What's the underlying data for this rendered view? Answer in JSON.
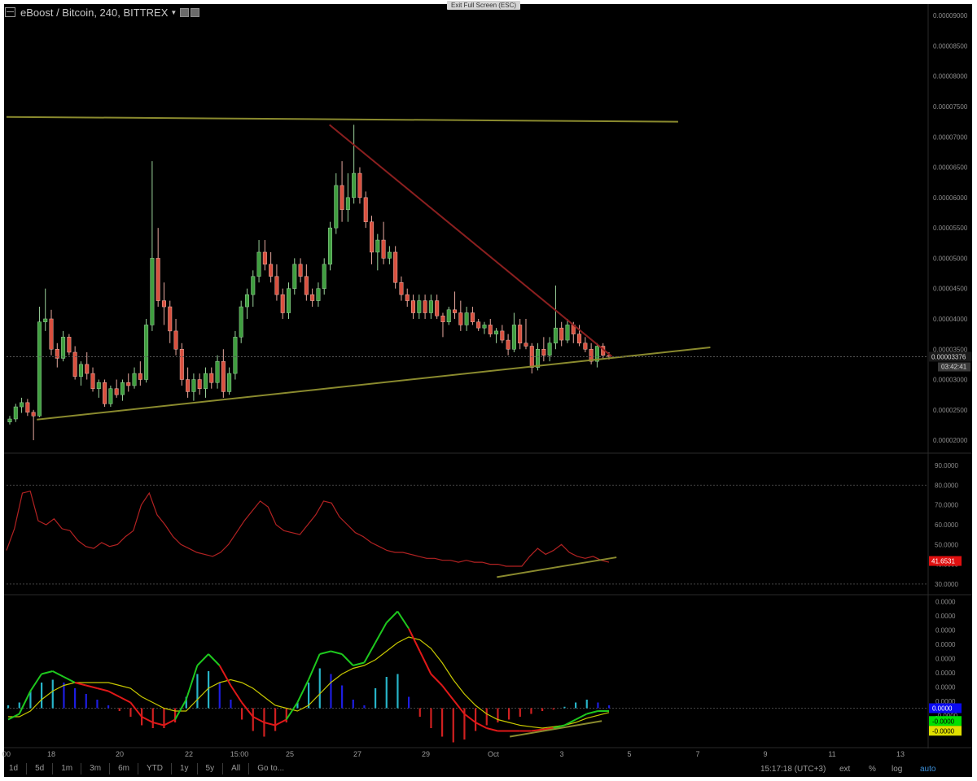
{
  "header": {
    "symbol": "eBoost / Bitcoin, 240, BITTREX"
  },
  "fullscreen_hint": "Exit Full Screen (ESC)",
  "toolbar": {
    "ranges": [
      "1d",
      "5d",
      "1m",
      "3m",
      "6m",
      "YTD",
      "1y",
      "5y",
      "All",
      "Go to..."
    ],
    "clock": "15:17:18 (UTC+3)",
    "ext": "ext",
    "percent": "%",
    "log": "log",
    "auto": "auto"
  },
  "colors": {
    "up": "#3f9e3f",
    "down": "#d9503f",
    "trendline": "#8a8a2e",
    "resistance": "#8b1f1f",
    "rsi": "#b22222",
    "macd": "#1ec81e",
    "signal": "#c8c800",
    "hist_pos_dark": "#1d1de0",
    "hist_pos_light": "#27b4c8",
    "hist_neg": "#d02020"
  },
  "chart_data": [
    {
      "type": "candlestick",
      "pane": "price",
      "x_ticks": [
        "00",
        "18",
        "20",
        "22",
        "15:00",
        "25",
        "27",
        "29",
        "Oct",
        "3",
        "5",
        "7",
        "9",
        "11",
        "13"
      ],
      "y_ticks": [
        "0.00009000",
        "0.00008500",
        "0.00008000",
        "0.00007500",
        "0.00007000",
        "0.00006500",
        "0.00006000",
        "0.00005500",
        "0.00005000",
        "0.00004500",
        "0.00004000",
        "0.00003500",
        "0.00003000",
        "0.00002500",
        "0.00002000"
      ],
      "ylim": [
        1.8e-05,
        9.15e-05
      ],
      "last_price_label": "0.00003376",
      "countdown_label": "03:42:41",
      "candles": [
        [
          2.3e-05,
          2.4e-05,
          2.26e-05,
          2.35e-05
        ],
        [
          2.35e-05,
          2.6e-05,
          2.3e-05,
          2.55e-05
        ],
        [
          2.55e-05,
          2.7e-05,
          2.45e-05,
          2.62e-05
        ],
        [
          2.62e-05,
          2.68e-05,
          2.4e-05,
          2.46e-05
        ],
        [
          2.46e-05,
          2.5e-05,
          2e-05,
          2.4e-05
        ],
        [
          2.4e-05,
          4.2e-05,
          2.38e-05,
          3.95e-05
        ],
        [
          3.95e-05,
          4.5e-05,
          3.8e-05,
          4e-05
        ],
        [
          4e-05,
          4.15e-05,
          3.4e-05,
          3.5e-05
        ],
        [
          3.5e-05,
          3.6e-05,
          3.2e-05,
          3.35e-05
        ],
        [
          3.35e-05,
          3.8e-05,
          3.3e-05,
          3.7e-05
        ],
        [
          3.7e-05,
          3.75e-05,
          3.4e-05,
          3.45e-05
        ],
        [
          3.45e-05,
          3.55e-05,
          3e-05,
          3.05e-05
        ],
        [
          3.05e-05,
          3.3e-05,
          2.9e-05,
          3.25e-05
        ],
        [
          3.25e-05,
          3.45e-05,
          3e-05,
          3.1e-05
        ],
        [
          3.1e-05,
          3.2e-05,
          2.8e-05,
          2.85e-05
        ],
        [
          2.85e-05,
          3e-05,
          2.7e-05,
          2.95e-05
        ],
        [
          2.95e-05,
          3e-05,
          2.55e-05,
          2.6e-05
        ],
        [
          2.6e-05,
          2.9e-05,
          2.55e-05,
          2.85e-05
        ],
        [
          2.85e-05,
          3e-05,
          2.7e-05,
          2.75e-05
        ],
        [
          2.75e-05,
          3e-05,
          2.65e-05,
          2.95e-05
        ],
        [
          2.95e-05,
          3.1e-05,
          2.8e-05,
          2.9e-05
        ],
        [
          2.9e-05,
          3.2e-05,
          2.85e-05,
          3.1e-05
        ],
        [
          3.1e-05,
          3.3e-05,
          2.9e-05,
          3e-05
        ],
        [
          3e-05,
          4e-05,
          2.95e-05,
          3.9e-05
        ],
        [
          3.9e-05,
          6.6e-05,
          3.8e-05,
          5e-05
        ],
        [
          5e-05,
          5.5e-05,
          4.2e-05,
          4.3e-05
        ],
        [
          4.3e-05,
          4.6e-05,
          3.9e-05,
          4.2e-05
        ],
        [
          4.2e-05,
          4.3e-05,
          3.6e-05,
          3.8e-05
        ],
        [
          3.8e-05,
          4e-05,
          3.4e-05,
          3.5e-05
        ],
        [
          3.5e-05,
          3.6e-05,
          2.9e-05,
          3e-05
        ],
        [
          3e-05,
          3.2e-05,
          2.7e-05,
          2.8e-05
        ],
        [
          2.8e-05,
          3.1e-05,
          2.65e-05,
          3e-05
        ],
        [
          3e-05,
          3.1e-05,
          2.75e-05,
          2.85e-05
        ],
        [
          2.85e-05,
          3.2e-05,
          2.7e-05,
          3.1e-05
        ],
        [
          3.1e-05,
          3.2e-05,
          2.85e-05,
          2.95e-05
        ],
        [
          2.95e-05,
          3.4e-05,
          2.85e-05,
          3.3e-05
        ],
        [
          3.3e-05,
          3.5e-05,
          2.7e-05,
          2.8e-05
        ],
        [
          2.8e-05,
          3.2e-05,
          2.75e-05,
          3.1e-05
        ],
        [
          3.1e-05,
          3.8e-05,
          3e-05,
          3.7e-05
        ],
        [
          3.7e-05,
          4.3e-05,
          3.6e-05,
          4.2e-05
        ],
        [
          4.2e-05,
          4.5e-05,
          4e-05,
          4.4e-05
        ],
        [
          4.4e-05,
          4.8e-05,
          4.2e-05,
          4.7e-05
        ],
        [
          4.7e-05,
          5.3e-05,
          4.6e-05,
          5.1e-05
        ],
        [
          5.1e-05,
          5.3e-05,
          4.8e-05,
          4.9e-05
        ],
        [
          4.9e-05,
          5.1e-05,
          4.6e-05,
          4.7e-05
        ],
        [
          4.7e-05,
          4.9e-05,
          4.3e-05,
          4.4e-05
        ],
        [
          4.4e-05,
          4.5e-05,
          4e-05,
          4.1e-05
        ],
        [
          4.1e-05,
          4.6e-05,
          4e-05,
          4.5e-05
        ],
        [
          4.5e-05,
          5e-05,
          4.4e-05,
          4.9e-05
        ],
        [
          4.9e-05,
          5e-05,
          4.6e-05,
          4.7e-05
        ],
        [
          4.7e-05,
          4.9e-05,
          4.3e-05,
          4.4e-05
        ],
        [
          4.4e-05,
          4.5e-05,
          4.2e-05,
          4.3e-05
        ],
        [
          4.3e-05,
          4.6e-05,
          4.2e-05,
          4.5e-05
        ],
        [
          4.5e-05,
          5e-05,
          4.4e-05,
          4.9e-05
        ],
        [
          4.9e-05,
          5.6e-05,
          4.8e-05,
          5.5e-05
        ],
        [
          5.5e-05,
          6.4e-05,
          5.4e-05,
          6.2e-05
        ],
        [
          6.2e-05,
          6.6e-05,
          5.6e-05,
          5.8e-05
        ],
        [
          5.8e-05,
          6.4e-05,
          5.6e-05,
          6e-05
        ],
        [
          6e-05,
          7.2e-05,
          5.9e-05,
          6.4e-05
        ],
        [
          6.4e-05,
          6.5e-05,
          5.9e-05,
          6e-05
        ],
        [
          6e-05,
          6.1e-05,
          5.5e-05,
          5.6e-05
        ],
        [
          5.6e-05,
          5.7e-05,
          4.9e-05,
          5.1e-05
        ],
        [
          5.1e-05,
          5.4e-05,
          4.8e-05,
          5.3e-05
        ],
        [
          5.3e-05,
          5.6e-05,
          4.9e-05,
          5e-05
        ],
        [
          5e-05,
          5.2e-05,
          4.9e-05,
          5.1e-05
        ],
        [
          5.1e-05,
          5.2e-05,
          4.5e-05,
          4.6e-05
        ],
        [
          4.6e-05,
          4.7e-05,
          4.3e-05,
          4.4e-05
        ],
        [
          4.4e-05,
          4.5e-05,
          4.2e-05,
          4.3e-05
        ],
        [
          4.3e-05,
          4.4e-05,
          4e-05,
          4.1e-05
        ],
        [
          4.1e-05,
          4.4e-05,
          4e-05,
          4.3e-05
        ],
        [
          4.3e-05,
          4.4e-05,
          4e-05,
          4.1e-05
        ],
        [
          4.1e-05,
          4.4e-05,
          4e-05,
          4.3e-05
        ],
        [
          4.3e-05,
          4.4e-05,
          4e-05,
          4.05e-05
        ],
        [
          4.05e-05,
          4.1e-05,
          3.7e-05,
          3.95e-05
        ],
        [
          3.95e-05,
          4.2e-05,
          3.9e-05,
          4.15e-05
        ],
        [
          4.15e-05,
          4.45e-05,
          4e-05,
          4.1e-05
        ],
        [
          4.1e-05,
          4.3e-05,
          3.8e-05,
          3.9e-05
        ],
        [
          3.9e-05,
          4.2e-05,
          3.8e-05,
          4.1e-05
        ],
        [
          4.1e-05,
          4.2e-05,
          3.9e-05,
          3.95e-05
        ],
        [
          3.95e-05,
          4e-05,
          3.8e-05,
          3.85e-05
        ],
        [
          3.85e-05,
          3.95e-05,
          3.75e-05,
          3.9e-05
        ],
        [
          3.9e-05,
          4e-05,
          3.7e-05,
          3.75e-05
        ],
        [
          3.75e-05,
          3.85e-05,
          3.6e-05,
          3.8e-05
        ],
        [
          3.8e-05,
          3.9e-05,
          3.6e-05,
          3.65e-05
        ],
        [
          3.65e-05,
          3.75e-05,
          3.4e-05,
          3.5e-05
        ],
        [
          3.5e-05,
          4.1e-05,
          3.45e-05,
          3.9e-05
        ],
        [
          3.9e-05,
          4e-05,
          3.5e-05,
          3.6e-05
        ],
        [
          3.6e-05,
          4e-05,
          3.5e-05,
          3.55e-05
        ],
        [
          3.55e-05,
          3.6e-05,
          3.1e-05,
          3.2e-05
        ],
        [
          3.2e-05,
          3.6e-05,
          3.15e-05,
          3.5e-05
        ],
        [
          3.5e-05,
          3.7e-05,
          3.3e-05,
          3.4e-05
        ],
        [
          3.4e-05,
          3.7e-05,
          3.3e-05,
          3.6e-05
        ],
        [
          3.6e-05,
          4.55e-05,
          3.5e-05,
          3.85e-05
        ],
        [
          3.85e-05,
          3.95e-05,
          3.55e-05,
          3.65e-05
        ],
        [
          3.65e-05,
          4e-05,
          3.6e-05,
          3.9e-05
        ],
        [
          3.9e-05,
          3.95e-05,
          3.6e-05,
          3.75e-05
        ],
        [
          3.75e-05,
          3.9e-05,
          3.55e-05,
          3.6e-05
        ],
        [
          3.6e-05,
          3.7e-05,
          3.45e-05,
          3.5e-05
        ],
        [
          3.5e-05,
          3.6e-05,
          3.25e-05,
          3.3e-05
        ],
        [
          3.3e-05,
          3.6e-05,
          3.2e-05,
          3.55e-05
        ],
        [
          3.55e-05,
          3.6e-05,
          3.35e-05,
          3.4e-05
        ],
        [
          3.4e-05,
          3.45e-05,
          3.33e-05,
          3.38e-05
        ]
      ],
      "trendlines": [
        {
          "name": "top-horizontal",
          "x_frac": [
            0.0,
            0.73
          ],
          "y": [
            7.33e-05,
            7.25e-05
          ]
        },
        {
          "name": "bottom-support",
          "x_frac": [
            0.033,
            0.765
          ],
          "y": [
            2.34e-05,
            3.53e-05
          ]
        },
        {
          "name": "descending-resistance",
          "x_frac": [
            0.351,
            0.658
          ],
          "y": [
            7.2e-05,
            3.38e-05
          ]
        }
      ]
    },
    {
      "type": "line",
      "pane": "rsi",
      "y_ticks": [
        "90.0000",
        "80.0000",
        "70.0000",
        "60.0000",
        "50.0000",
        "40.0000",
        "30.0000"
      ],
      "ylim": [
        25,
        95
      ],
      "bands": [
        80,
        30
      ],
      "last_value_label": "41.6531",
      "values": [
        47,
        58,
        76,
        77,
        62,
        60,
        63,
        58,
        57,
        52,
        49,
        48,
        51,
        49,
        50,
        54,
        57,
        70,
        76,
        65,
        60,
        54,
        50,
        48,
        46,
        45,
        44,
        46,
        50,
        56,
        62,
        67,
        72,
        69,
        60,
        57,
        56,
        55,
        60,
        65,
        72,
        71,
        64,
        60,
        56,
        54,
        51,
        49,
        47,
        46,
        46,
        45,
        44,
        43,
        43,
        42,
        42,
        41,
        42,
        41,
        41,
        40,
        40,
        39,
        39,
        39,
        44,
        48,
        45,
        47,
        50,
        46,
        44,
        43,
        44,
        42,
        41
      ],
      "support_line": {
        "x_frac": [
          0.533,
          0.663
        ],
        "y": [
          33.5,
          43.5
        ]
      }
    },
    {
      "type": "macd",
      "pane": "macd",
      "y_ticks": [
        "0.0000",
        "0.0000",
        "0.0000",
        "0.0000",
        "0.0000",
        "0.0000",
        "0.0000",
        "0.0000",
        "-0.0000"
      ],
      "ylim": [
        -1.3,
        3.9
      ],
      "zero_label": "0.0000",
      "macd_label": "-0.0000",
      "signal_label": "-0.0000",
      "macd": [
        -0.4,
        -0.2,
        0.6,
        1.2,
        1.3,
        1.1,
        0.9,
        0.8,
        0.7,
        0.6,
        0.4,
        0.2,
        -0.3,
        -0.5,
        -0.6,
        -0.4,
        0.3,
        1.5,
        1.9,
        1.5,
        0.8,
        0.2,
        -0.3,
        -0.5,
        -0.6,
        -0.4,
        0.2,
        1.0,
        1.9,
        2.0,
        1.9,
        1.5,
        1.6,
        2.3,
        3.0,
        3.4,
        2.8,
        2.0,
        1.2,
        0.8,
        0.3,
        -0.2,
        -0.5,
        -0.7,
        -0.8,
        -0.8,
        -0.8,
        -0.8,
        -0.75,
        -0.7,
        -0.6,
        -0.4,
        -0.2,
        -0.1,
        -0.1
      ],
      "signal": [
        -0.3,
        -0.3,
        -0.1,
        0.3,
        0.6,
        0.8,
        0.9,
        0.9,
        0.9,
        0.9,
        0.8,
        0.7,
        0.4,
        0.2,
        0.0,
        -0.1,
        -0.1,
        0.3,
        0.7,
        0.9,
        1.0,
        0.9,
        0.7,
        0.4,
        0.1,
        0.0,
        -0.1,
        0.1,
        0.5,
        0.9,
        1.2,
        1.4,
        1.5,
        1.7,
        2.0,
        2.3,
        2.5,
        2.4,
        2.1,
        1.6,
        1.0,
        0.5,
        0.1,
        -0.2,
        -0.4,
        -0.5,
        -0.6,
        -0.65,
        -0.7,
        -0.65,
        -0.6,
        -0.5,
        -0.35,
        -0.25,
        -0.15
      ],
      "histogram": [
        0.1,
        0.2,
        0.6,
        0.9,
        1.0,
        0.9,
        0.7,
        0.5,
        0.3,
        0.1,
        -0.1,
        -0.3,
        -0.6,
        -0.7,
        -0.7,
        -0.5,
        0.4,
        1.2,
        1.3,
        0.9,
        0.3,
        -0.4,
        -0.8,
        -1.0,
        -0.8,
        -0.5,
        0.2,
        0.9,
        1.4,
        1.2,
        0.8,
        0.3,
        0.1,
        0.7,
        1.1,
        1.2,
        0.4,
        -0.3,
        -0.7,
        -1.0,
        -1.2,
        -1.1,
        -0.8,
        -0.6,
        -0.5,
        -0.4,
        -0.3,
        -0.2,
        -0.1,
        -0.05,
        0.05,
        0.2,
        0.3,
        0.2,
        0.1
      ],
      "support_line": {
        "x_frac": [
          0.547,
          0.647
        ],
        "y": [
          -1.0,
          -0.45
        ]
      }
    }
  ]
}
